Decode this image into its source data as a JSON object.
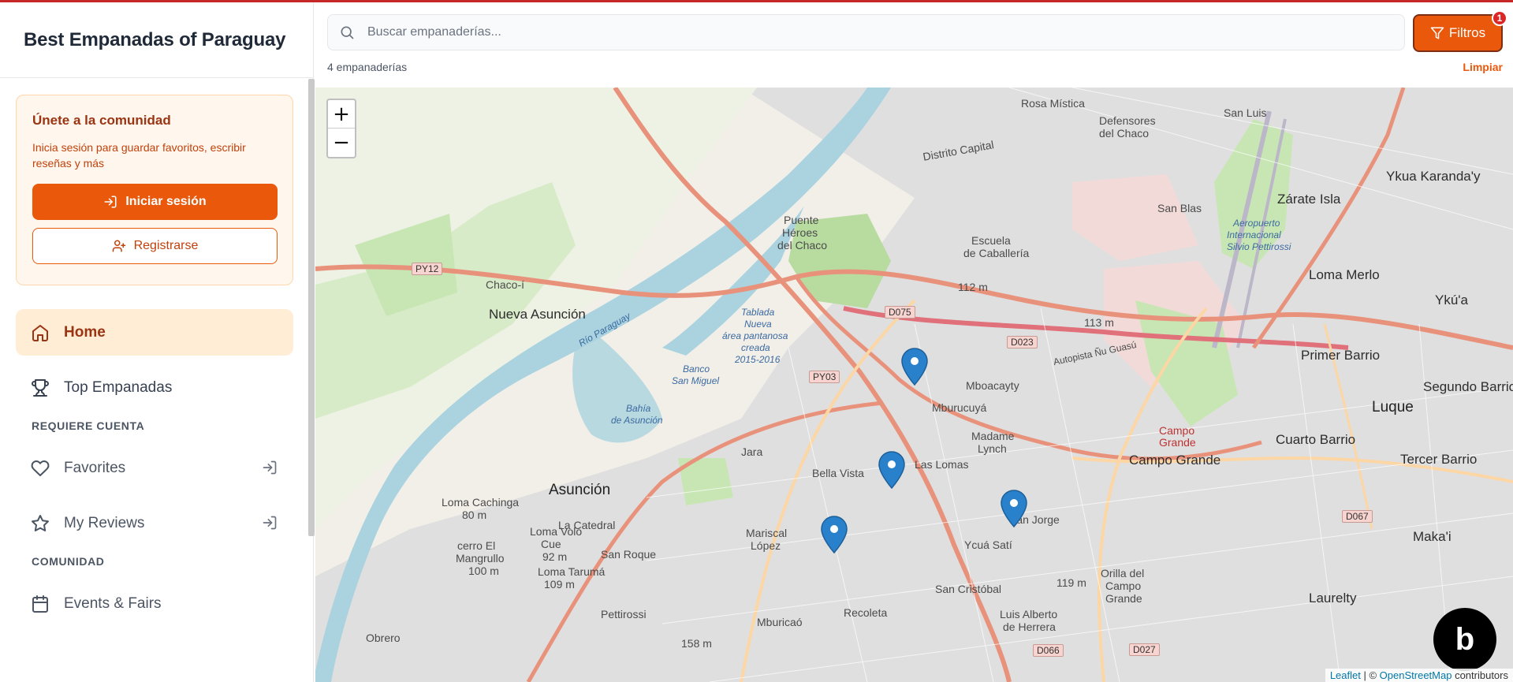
{
  "app": {
    "title": "Best Empanadas of Paraguay"
  },
  "join": {
    "title": "Únete a la comunidad",
    "text": "Inicia sesión para guardar favoritos, escribir reseñas y más",
    "login": "Iniciar sesión",
    "register": "Registrarse"
  },
  "nav": {
    "home": "Home",
    "top": "Top Empanadas",
    "section_account": "REQUIERE CUENTA",
    "favorites": "Favorites",
    "reviews": "My Reviews",
    "section_community": "COMUNIDAD",
    "events": "Events & Fairs"
  },
  "search": {
    "placeholder": "Buscar empanaderías...",
    "value": ""
  },
  "filters": {
    "label": "Filtros",
    "badge": "1"
  },
  "results": {
    "count": "4 empanaderías",
    "clear": "Limpiar"
  },
  "map": {
    "zoom_in": "+",
    "zoom_out": "−",
    "attribution_leaflet": "Leaflet",
    "attribution_sep": " | © ",
    "attribution_osm": "OpenStreetMap",
    "attribution_tail": " contributors",
    "labels": {
      "asuncion": "Asunción",
      "luque": "Luque",
      "nueva_asuncion": "Nueva Asunción",
      "chaco_i": "Chaco-í",
      "campo_grande": "Campo Grande",
      "loma_merlo": "Loma Merlo",
      "primer_barrio": "Primer Barrio",
      "segundo_barrio": "Segundo Barrio",
      "cuarto_barrio": "Cuarto Barrio",
      "tercer_barrio": "Tercer Barrio",
      "zarate_isla": "Zárate Isla",
      "ykua_karanday": "Ykua Karanda'y",
      "laurelty": "Laurelty",
      "puente": "Puente",
      "heroes": "Héroes",
      "del_chaco": "del Chaco",
      "mboacayty": "Mboacayty",
      "mburucuya": "Mburucuyá",
      "madame_lynch": "Madame",
      "lynch": "Lynch",
      "las_lomas": "Las Lomas",
      "bella_vista": "Bella Vista",
      "recoleta": "Recoleta",
      "jara": "Jara",
      "loma_cachinga": "Loma Cachinga",
      "san_jorge": "San Jorge",
      "ycua_sati": "Ycuá Satí",
      "escuela": "Escuela",
      "de_caballeria": "de Caballería",
      "aeropuerto": "Aeropuerto",
      "internacional": "Internacional",
      "silvio": "Silvio Pettirossi",
      "rio_paraguay": "Río Paraguay",
      "tablada": "Tablada",
      "nueva": "Nueva",
      "area": "área pantanosa",
      "creada": "creada",
      "year": "2015-2016",
      "banco": "Banco",
      "san_miguel": "San Miguel",
      "bahia": "Bahía",
      "de_asuncion": "de Asunción",
      "autopista": "Autopista Ñu Guasú",
      "distrito": "Distrito Capital",
      "rosa_mistica": "Rosa Mística",
      "defensores": "Defensores",
      "del_chaco2": "del Chaco",
      "san_blas": "San Blas",
      "san_luis": "San Luis",
      "mariscal_lopez": "Mariscal",
      "lopez": "López",
      "san_cristobal": "San Cristóbal",
      "luis_alberto": "Luis Alberto",
      "de_herrera": "de Herrera",
      "obrero": "Obrero",
      "mburicao": "Mburicaó",
      "loma_volo": "Loma Volo",
      "cue": "Cue",
      "cerro_el": "cerro El",
      "mangrullo": "Mangrullo",
      "loma_taruma": "Loma Tarumá",
      "pettirossi": "Pettirossi",
      "san_roque": "San Roque",
      "la_catedral": "La Catedral",
      "orilla": "Orilla del",
      "campo": "Campo",
      "grande": "Grande",
      "makai": "Maka'i",
      "ykua": "Ykú'a",
      "cg_label": "Campo",
      "cg_label2": "Grande"
    },
    "elevations": {
      "e112": "112 m",
      "e113": "113 m",
      "e119": "119 m",
      "e80": "80 m",
      "e92": "92 m",
      "e100": "100 m",
      "e109": "109 m",
      "e158": "158 m"
    },
    "roads": {
      "py12": "PY12",
      "py03": "PY03",
      "d075": "D075",
      "d023": "D023",
      "d067": "D067",
      "d066": "D066",
      "d027": "D027"
    },
    "markers": [
      {
        "name": "empanaderia-1"
      },
      {
        "name": "empanaderia-2"
      },
      {
        "name": "empanaderia-3"
      },
      {
        "name": "empanaderia-4"
      }
    ]
  },
  "colors": {
    "accent": "#ea580c",
    "water": "#aad3df",
    "park": "#c8e6b4",
    "marker": "#2a81cb"
  }
}
